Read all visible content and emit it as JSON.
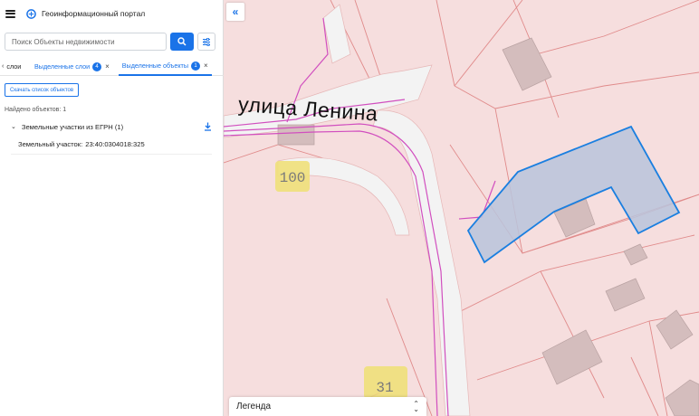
{
  "header": {
    "title": "Геоинформационный портал"
  },
  "search": {
    "placeholder": "Поиск Объекты недвижимости"
  },
  "tabs": {
    "back_label": "слои",
    "items": [
      {
        "label": "Выделенные слои",
        "badge": "4"
      },
      {
        "label": "Выделенные объекты",
        "badge": "1"
      }
    ],
    "close_glyph": "×"
  },
  "results": {
    "download_label": "Скачать список объектов",
    "found_label": "Найдено объектов: 1",
    "group_label": "Земельные участки из ЕГРН (1)",
    "item_label": "Земельный участок:",
    "item_value": "23:40:0304018:325"
  },
  "map": {
    "street_label": "улица Ленина",
    "house_numbers": [
      "100",
      "31"
    ],
    "legend_label": "Легенда",
    "collapse_glyph": "«"
  },
  "colors": {
    "accent": "#1a73e8",
    "parcel_fill": "#f6dede",
    "parcel_border": "#e08a8a",
    "road": "#f3f3f3",
    "utility_line": "#d14fbf",
    "selected_outline": "#1a7fe0",
    "selected_fill": "#b8c4dc",
    "building": "#d4bdbd",
    "house_number_bg": "#efe07a"
  },
  "icons": {
    "menu": "hamburger-icon",
    "logo": "portal-logo-icon",
    "search": "search-icon",
    "filter": "filter-icon",
    "download": "download-icon",
    "collapse": "double-chevron-left-icon"
  }
}
